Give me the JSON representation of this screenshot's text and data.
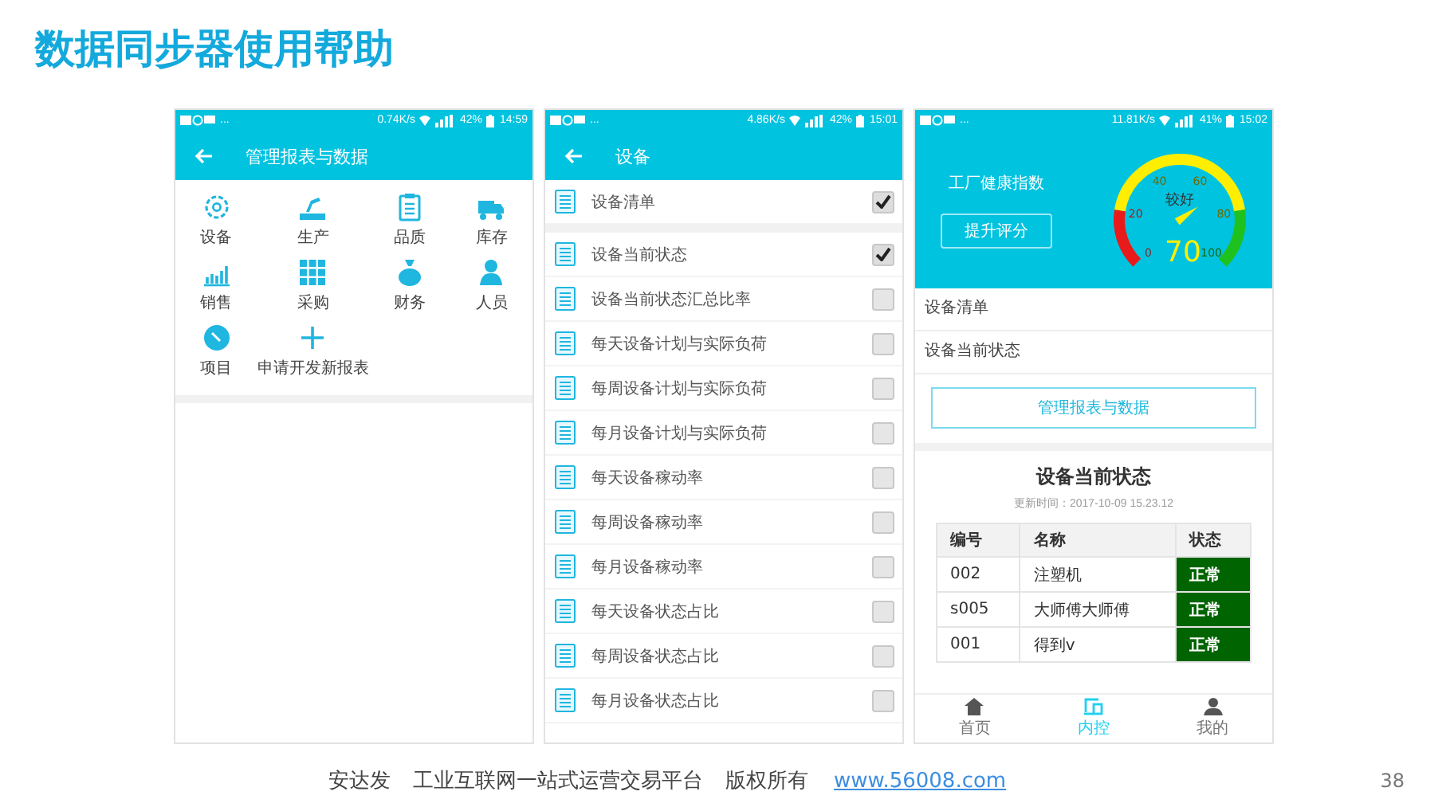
{
  "title": "数据同步器使用帮助",
  "phones": [
    {
      "kind": "menu",
      "status": {
        "more": "...",
        "speed": "0.74K/s",
        "battery": "42%",
        "time": "14:59"
      },
      "header": "管理报表与数据",
      "items": [
        {
          "label": "设备"
        },
        {
          "label": "生产"
        },
        {
          "label": "品质"
        },
        {
          "label": "库存"
        },
        {
          "label": "销售"
        },
        {
          "label": "采购"
        },
        {
          "label": "财务"
        },
        {
          "label": "人员"
        },
        {
          "label": "项目"
        },
        {
          "label": "申请开发新报表"
        }
      ]
    },
    {
      "kind": "checklist",
      "status": {
        "more": "...",
        "speed": "4.86K/s",
        "battery": "42%",
        "time": "15:01"
      },
      "header": "设备",
      "sections": [
        {
          "items": [
            {
              "label": "设备清单",
              "checked": true
            }
          ]
        },
        {
          "items": [
            {
              "label": "设备当前状态",
              "checked": true
            },
            {
              "label": "设备当前状态汇总比率",
              "checked": false
            },
            {
              "label": "每天设备计划与实际负荷",
              "checked": false
            },
            {
              "label": "每周设备计划与实际负荷",
              "checked": false
            },
            {
              "label": "每月设备计划与实际负荷",
              "checked": false
            },
            {
              "label": "每天设备稼动率",
              "checked": false
            },
            {
              "label": "每周设备稼动率",
              "checked": false
            },
            {
              "label": "每月设备稼动率",
              "checked": false
            },
            {
              "label": "每天设备状态占比",
              "checked": false
            },
            {
              "label": "每周设备状态占比",
              "checked": false
            },
            {
              "label": "每月设备状态占比",
              "checked": false
            }
          ]
        }
      ]
    },
    {
      "kind": "dashboard",
      "status": {
        "more": "...",
        "speed": "11.81K/s",
        "battery": "41%",
        "time": "15:02"
      },
      "health": {
        "title": "工厂健康指数",
        "button": "提升评分",
        "gauge": {
          "rating": "较好",
          "reading": "70",
          "ticks": [
            "0",
            "20",
            "40",
            "60",
            "80",
            "100"
          ]
        }
      },
      "links": [
        "设备清单",
        "设备当前状态"
      ],
      "manage_button": "管理报表与数据",
      "card": {
        "title": "设备当前状态",
        "updated": "更新时间：2017-10-09 15.23.12",
        "columns": [
          "编号",
          "名称",
          "状态"
        ],
        "rows": [
          [
            "002",
            "注塑机",
            "正常"
          ],
          [
            "s005",
            "大师傅大师傅",
            "正常"
          ],
          [
            "001",
            "得到v",
            "正常"
          ]
        ]
      },
      "nav": [
        {
          "label": "首页",
          "selected": false
        },
        {
          "label": "内控",
          "selected": true
        },
        {
          "label": "我的",
          "selected": false
        }
      ]
    }
  ],
  "footer": {
    "company": "安达发",
    "slogan": "工业互联网一站式运营交易平台",
    "rights": "版权所有",
    "link": "www.56008.com",
    "page": "38"
  }
}
